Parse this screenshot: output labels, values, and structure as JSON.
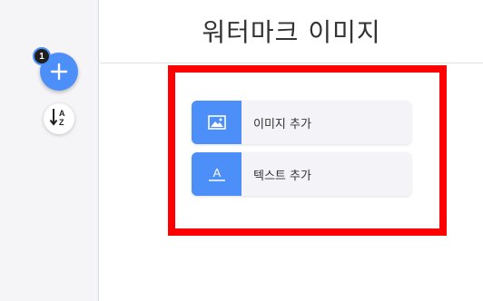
{
  "header": {
    "title": "워터마크 이미지"
  },
  "sidebar": {
    "add_button": {
      "icon": "plus-icon",
      "badge": "1"
    },
    "sort_button": {
      "icon": "sort-a-z-icon",
      "top_letter": "A",
      "bottom_letter": "Z"
    }
  },
  "menu": {
    "items": [
      {
        "label": "이미지 추가",
        "icon": "image-icon"
      },
      {
        "label": "텍스트 추가",
        "icon": "text-icon",
        "glyph": "A"
      }
    ]
  },
  "colors": {
    "accent": "#4d8ff8",
    "highlight": "#ff0000"
  }
}
